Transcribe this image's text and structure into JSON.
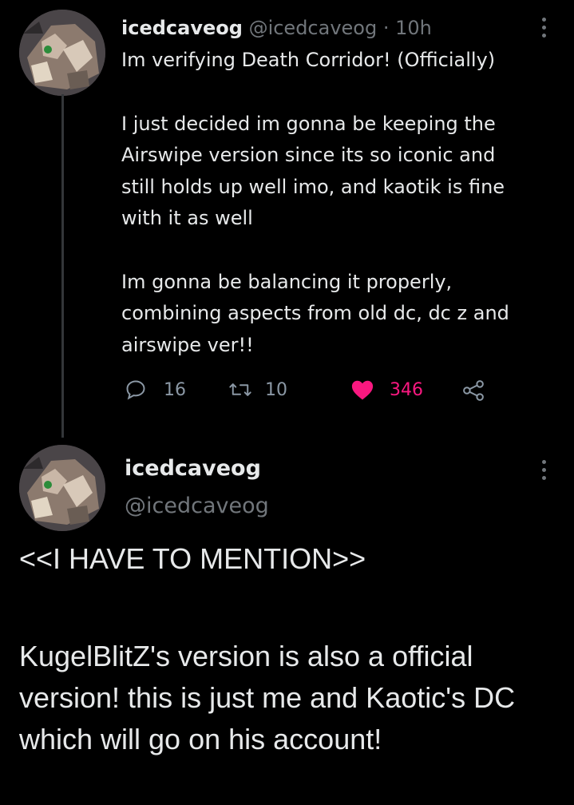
{
  "tweet1": {
    "display_name": "icedcaveog",
    "handle": "@icedcaveog",
    "separator": "·",
    "time": "10h",
    "paragraphs": [
      "Im verifying Death Corridor! (Officially)",
      "I just decided im gonna be keeping the\nAirswipe version since its so iconic and\nstill holds up well imo, and kaotik is fine\nwith it as well",
      "Im gonna be balancing it properly,\ncombining aspects from old dc, dc z and\nairswipe ver!!"
    ],
    "replies": "16",
    "retweets": "10",
    "likes": "346",
    "liked": true
  },
  "tweet2": {
    "display_name": "icedcaveog",
    "handle": "@icedcaveog",
    "paragraphs": [
      "<<I HAVE TO MENTION>>",
      "KugelBlitZ's version is also a official version! this is just me and Kaotic's DC which will go on his account!"
    ]
  },
  "colors": {
    "background": "#000000",
    "text": "#e7e9ea",
    "muted": "#71767b",
    "like": "#f91880",
    "thread_line": "#333639"
  },
  "icons": {
    "reply": "reply-icon",
    "retweet": "retweet-icon",
    "like": "heart-icon",
    "share": "share-icon",
    "more": "more-vertical-icon"
  }
}
